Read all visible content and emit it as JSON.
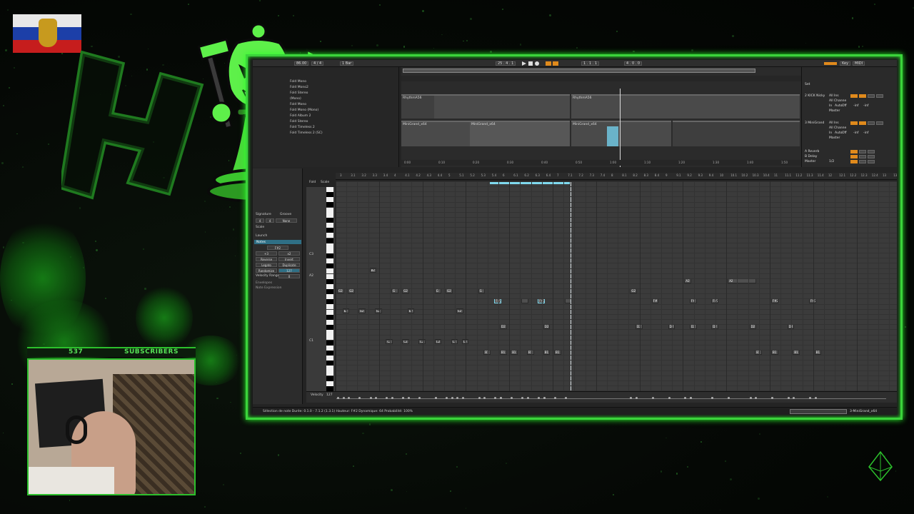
{
  "overlay": {
    "subscriber_count": "537",
    "subscriber_label": "SUBSCRIBERS"
  },
  "daw": {
    "transport": {
      "tempo": "86.00",
      "meter": "4 / 4",
      "quant": "1 Bar",
      "position": "25 . 4 . 1",
      "loop_start": "1 . 1 . 1",
      "loop_length": "4 . 0 . 0",
      "key_label": "Key",
      "midi_label": "MIDI"
    },
    "browser": {
      "items": [
        "Fold Mono",
        "Fold Mono2",
        "Fold Stereo",
        "(Mono)",
        "Fold Mono",
        "Fold Mono (Mono)",
        "Fold Album 2",
        "Fold Stereo",
        "Fold Timeless 2",
        "Fold Timeless 2 (SC)"
      ]
    },
    "arrangement": {
      "tracks": [
        {
          "name": "RhythmA56",
          "clip2": "RhythmA56"
        },
        {
          "name": "MiniGrand_x64",
          "clip2": "MiniGrand_x64",
          "clip3": "MiniGrand_x64"
        }
      ],
      "time_labels": [
        "0:00",
        "0:10",
        "0:20",
        "0:30",
        "0:40",
        "0:50",
        "1:00",
        "1:10",
        "1:20",
        "1:30",
        "1:40",
        "1:50"
      ]
    },
    "mixer": {
      "set_label": "Set",
      "tracks": [
        {
          "name": "2 KICK Nicky",
          "input": "All Ins",
          "channel": "All Channe",
          "monitor_in": "In",
          "monitor_auto": "Auto",
          "monitor_off": "Off",
          "vol": "-inf",
          "pan": "-inf",
          "out": "Master"
        },
        {
          "name": "3 MiniGrand",
          "input": "All Ins",
          "channel": "All Channe",
          "monitor_in": "In",
          "monitor_auto": "Auto",
          "monitor_off": "Off",
          "vol": "-inf",
          "pan": "-inf",
          "out": "Master"
        }
      ],
      "returns": [
        "A Reverb",
        "B Delay",
        "Master"
      ],
      "master_val": "1/2"
    },
    "clip_panel": {
      "signature_label": "Signature",
      "groove_label": "Groove",
      "sig_num": "4",
      "sig_den": "4",
      "groove_val": "None",
      "scale_label": "Scale",
      "launch_label": "Launch",
      "notes_label": "Notes",
      "note_value": "F#2",
      "plus": "+3",
      "double": "x2",
      "reverse": "Reverse",
      "invert": "Invert",
      "legato": "Legato",
      "duplicate": "Duplicate",
      "randomize": "Randomize",
      "rand_val": "127",
      "vel_range": "Velocity Range",
      "vel_range_val": "0",
      "sec1": "Envelopes",
      "sec2": "Note Expression"
    },
    "piano": {
      "fold": "Fold",
      "scale": "Scale",
      "labels": [
        "C3",
        "A2",
        "C1"
      ]
    },
    "ruler": [
      "3",
      "3.1",
      "3.2",
      "3.3",
      "3.4",
      "4",
      "4.1",
      "4.2",
      "4.3",
      "4.4",
      "5",
      "5.1",
      "5.2",
      "5.3",
      "5.4",
      "6",
      "6.1",
      "6.2",
      "6.3",
      "6.4",
      "7",
      "7.1",
      "7.2",
      "7.3",
      "7.4",
      "8",
      "8.1",
      "8.2",
      "8.3",
      "8.4",
      "9",
      "9.1",
      "9.2",
      "9.3",
      "9.4",
      "10",
      "10.1",
      "10.2",
      "10.3",
      "10.4",
      "11",
      "11.1",
      "11.2",
      "11.3",
      "11.4",
      "12",
      "12.1",
      "12.2",
      "12.3",
      "12.4",
      "13",
      "13.1"
    ],
    "notes": [
      {
        "label": "B2",
        "c": 6,
        "d": 1
      },
      {
        "label": "A2",
        "c": 64,
        "d": 1
      },
      {
        "label": "A2",
        "c": 72,
        "d": 5
      },
      {
        "label": "G2",
        "c": 0,
        "d": 1
      },
      {
        "label": "G2",
        "c": 2,
        "d": 1
      },
      {
        "label": "G",
        "c": 10,
        "d": 1
      },
      {
        "label": "G2",
        "c": 12,
        "d": 1
      },
      {
        "label": "G",
        "c": 18,
        "d": 1
      },
      {
        "label": "G2",
        "c": 20,
        "d": 1
      },
      {
        "label": "G",
        "c": 26,
        "d": 1
      },
      {
        "label": "G2",
        "c": 54,
        "d": 1
      },
      {
        "label": "F#2",
        "c": 29,
        "d": 1
      },
      {
        "label": "",
        "c": 34,
        "d": 1
      },
      {
        "label": "F#2",
        "c": 37,
        "d": 1
      },
      {
        "label": "",
        "c": 42,
        "d": 1
      },
      {
        "label": "F#2",
        "c": 58,
        "d": 1
      },
      {
        "label": "F#",
        "c": 65,
        "d": 1
      },
      {
        "label": "F#2",
        "c": 69,
        "d": 1
      },
      {
        "label": "F#2",
        "c": 80,
        "d": 1
      },
      {
        "label": "F#2",
        "c": 87,
        "d": 1
      },
      {
        "label": "E2",
        "c": 1,
        "d": 1
      },
      {
        "label": "E2",
        "c": 4,
        "d": 1
      },
      {
        "label": "E2",
        "c": 7,
        "d": 1
      },
      {
        "label": "E2",
        "c": 13,
        "d": 1
      },
      {
        "label": "E2",
        "c": 22,
        "d": 1
      },
      {
        "label": "D2",
        "c": 30,
        "d": 1
      },
      {
        "label": "D2",
        "c": 38,
        "d": 1
      },
      {
        "label": "D2",
        "c": 55,
        "d": 1
      },
      {
        "label": "D2",
        "c": 61,
        "d": 1
      },
      {
        "label": "D2",
        "c": 65,
        "d": 1
      },
      {
        "label": "D2",
        "c": 69,
        "d": 1
      },
      {
        "label": "D2",
        "c": 76,
        "d": 1
      },
      {
        "label": "D2",
        "c": 83,
        "d": 1
      },
      {
        "label": "C2",
        "c": 9,
        "d": 1
      },
      {
        "label": "C2",
        "c": 12,
        "d": 1
      },
      {
        "label": "C2",
        "c": 15,
        "d": 1
      },
      {
        "label": "C2",
        "c": 18,
        "d": 1
      },
      {
        "label": "C2",
        "c": 21,
        "d": 1
      },
      {
        "label": "C2",
        "c": 23,
        "d": 1
      },
      {
        "label": "B1",
        "c": 27,
        "d": 1
      },
      {
        "label": "B1",
        "c": 30,
        "d": 1
      },
      {
        "label": "B1",
        "c": 32,
        "d": 1
      },
      {
        "label": "B1",
        "c": 35,
        "d": 1
      },
      {
        "label": "B1",
        "c": 38,
        "d": 1
      },
      {
        "label": "B1",
        "c": 40,
        "d": 1
      },
      {
        "label": "B1",
        "c": 77,
        "d": 1
      },
      {
        "label": "B1",
        "c": 80,
        "d": 1
      },
      {
        "label": "B1",
        "c": 84,
        "d": 1
      },
      {
        "label": "B1",
        "c": 88,
        "d": 1
      }
    ],
    "velocity_label": "Velocity",
    "velocity_val": "127",
    "status": {
      "text": "Sélection de note   Durée: 0.1.0 - 7.1.2 (1.3.1)   Hauteur: F#2   Dynamique: 64   Probabilité: 100%",
      "clip_name": "3-MiniGrand_x64"
    }
  },
  "colors": {
    "accent_green": "#3bd43b",
    "ableton_orange": "#e08a1c",
    "selection_cyan": "#7fd9ee"
  }
}
